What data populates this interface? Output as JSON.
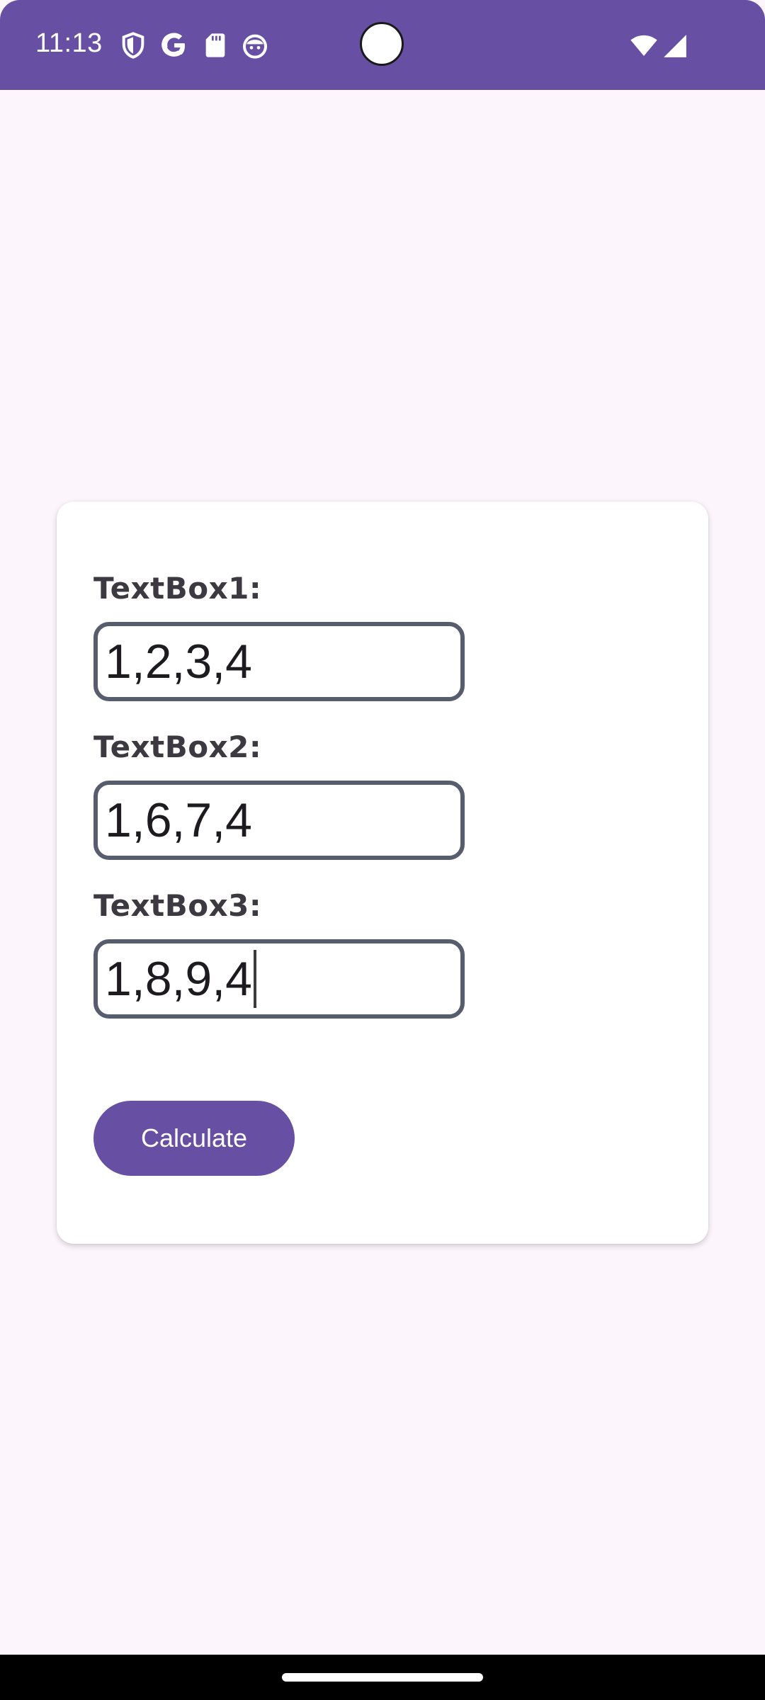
{
  "status_bar": {
    "time": "11:13",
    "left_icons": [
      "shield-icon",
      "google-icon",
      "sd-card-icon",
      "android-face-icon"
    ],
    "right_icons": [
      "wifi-icon",
      "cell-signal-icon"
    ],
    "background": "#6750a4"
  },
  "form": {
    "fields": [
      {
        "label": "TextBox1:",
        "value": "1,2,3,4"
      },
      {
        "label": "TextBox2:",
        "value": "1,6,7,4"
      },
      {
        "label": "TextBox3:",
        "value": "1,8,9,4"
      }
    ],
    "focused_field": "TextBox3:",
    "calculate_label": "Calculate"
  },
  "colors": {
    "accent": "#6750a4",
    "page_background": "#fcf5fc",
    "field_border": "#585d6e",
    "label_text": "#3d3940"
  }
}
